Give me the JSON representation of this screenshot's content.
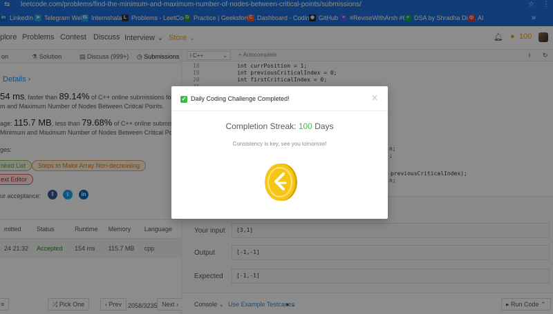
{
  "browser": {
    "url": "leetcode.com/problems/find-the-minimum-and-maximum-number-of-nodes-between-critical-points/submissions/",
    "bookmarks": [
      {
        "label": "LinkedIn",
        "color": "#0a66c2",
        "glyph": "in"
      },
      {
        "label": "Telegram Web",
        "color": "#2aa3df",
        "glyph": "➤"
      },
      {
        "label": "Internshala",
        "color": "#1ea1e7",
        "glyph": "IS"
      },
      {
        "label": "Problems - LeetCode",
        "color": "#333333",
        "glyph": "L"
      },
      {
        "label": "Practice | GeeksforG...",
        "color": "#2f8d46",
        "glyph": "G"
      },
      {
        "label": "Dashboard - Codin...",
        "color": "#f2542d",
        "glyph": "C"
      },
      {
        "label": "GitHub",
        "color": "#24292e",
        "glyph": "◉"
      },
      {
        "label": "#ReviseWithArsh #6...",
        "color": "#4b5fe0",
        "glyph": "≡"
      },
      {
        "label": "DSA by Shradha Did...",
        "color": "#1aa260",
        "glyph": "+"
      },
      {
        "label": "AI",
        "color": "#e53935",
        "glyph": "◎"
      }
    ]
  },
  "nav": {
    "items": [
      "plore",
      "Problems",
      "Contest",
      "Discuss",
      "Interview ⌄"
    ],
    "store": "Store ⌄",
    "coins": "100"
  },
  "left": {
    "tabs": [
      "on",
      "Solution",
      "Discuss (999+)",
      "Submissions"
    ],
    "details": "Details ›",
    "runtime": {
      "value": "54 ms",
      "pre": ", faster than ",
      "pct": "89.14%",
      "post": " of C++ online submissions for Find",
      "line2": "m and Maximum Number of Nodes Between Critical Points."
    },
    "memory": {
      "pre": "age: ",
      "value": "115.7 MB",
      "mid": ", less than ",
      "pct": "79.68%",
      "post": " of C++ online submissions",
      "line2": " Minimum and Maximum Number of Nodes Between Critical Points"
    },
    "tags_label": "ges:",
    "tags": [
      "nked List",
      "Steps to Make Array Non-decreasing",
      "ext Editor"
    ],
    "share_label": "ur acceptance:",
    "table": {
      "headers": [
        "mitted",
        "Status",
        "Runtime",
        "Memory",
        "Language"
      ],
      "row": [
        "24 21:32",
        "Accepted",
        "154 ms",
        "115.7 MB",
        "cpp"
      ]
    },
    "footer": {
      "pick_one": "Pick One",
      "prev": "‹ Prev",
      "pages": "2058/3235",
      "next": "Next ›"
    }
  },
  "editor": {
    "language": "C++",
    "autocomplete": "Autocomplete",
    "lines": [
      {
        "n": "18",
        "code": "int currPosition = 1;"
      },
      {
        "n": "19",
        "code": "int previousCriticalIndex = 0;"
      },
      {
        "n": "20",
        "code": "int firstCriticalIndex = 0;"
      },
      {
        "n": "21",
        "code": ""
      }
    ],
    "fragments": [
      "n;",
      ";",
      "previousCriticalIndex);",
      "n;"
    ]
  },
  "console": {
    "input_label": "Your input",
    "input": "[3,1]",
    "output_label": "Output",
    "output": "[-1,-1]",
    "expected_label": "Expected",
    "expected": "[-1,-1]",
    "console_btn": "Console ⌄",
    "use_example": "Use Example Testcases",
    "run_code": "Run Code ⌃"
  },
  "modal": {
    "title": "Daily Coding Challenge Completed!",
    "streak_label": "Completion Streak: ",
    "streak_value": "100",
    "streak_unit": " Days",
    "message": "Consistency is key, see you tomorrow!"
  },
  "colors": {
    "accent": "#1890ff",
    "success": "#3fb950",
    "brand": "#f89f1b",
    "coin": "#f5c518"
  }
}
